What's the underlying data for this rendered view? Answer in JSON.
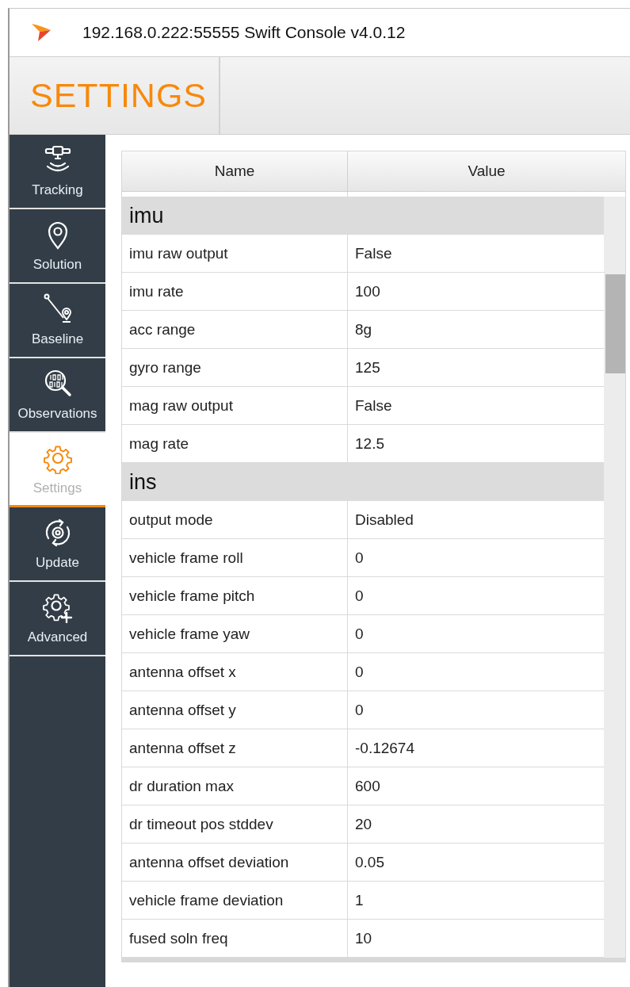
{
  "window": {
    "title": "192.168.0.222:55555 Swift Console v4.0.12"
  },
  "header": {
    "title": "SETTINGS"
  },
  "sidebar": {
    "items": [
      {
        "label": "Tracking",
        "selected": false
      },
      {
        "label": "Solution",
        "selected": false
      },
      {
        "label": "Baseline",
        "selected": false
      },
      {
        "label": "Observations",
        "selected": false
      },
      {
        "label": "Settings",
        "selected": true
      },
      {
        "label": "Update",
        "selected": false
      },
      {
        "label": "Advanced",
        "selected": false
      }
    ]
  },
  "table": {
    "columns": [
      "Name",
      "Value"
    ],
    "sections": [
      {
        "name": "imu",
        "rows": [
          {
            "name": "imu raw output",
            "value": "False"
          },
          {
            "name": "imu rate",
            "value": "100"
          },
          {
            "name": "acc range",
            "value": "8g"
          },
          {
            "name": "gyro range",
            "value": "125"
          },
          {
            "name": "mag raw output",
            "value": "False"
          },
          {
            "name": "mag rate",
            "value": "12.5"
          }
        ]
      },
      {
        "name": "ins",
        "rows": [
          {
            "name": "output mode",
            "value": "Disabled"
          },
          {
            "name": "vehicle frame roll",
            "value": "0"
          },
          {
            "name": "vehicle frame pitch",
            "value": "0"
          },
          {
            "name": "vehicle frame yaw",
            "value": "0"
          },
          {
            "name": "antenna offset x",
            "value": "0"
          },
          {
            "name": "antenna offset y",
            "value": "0"
          },
          {
            "name": "antenna offset z",
            "value": "-0.12674"
          },
          {
            "name": "dr duration max",
            "value": "600"
          },
          {
            "name": "dr timeout pos stddev",
            "value": "20"
          },
          {
            "name": "antenna offset deviation",
            "value": "0.05"
          },
          {
            "name": "vehicle frame deviation",
            "value": "1"
          },
          {
            "name": "fused soln freq",
            "value": "10"
          }
        ]
      }
    ]
  }
}
